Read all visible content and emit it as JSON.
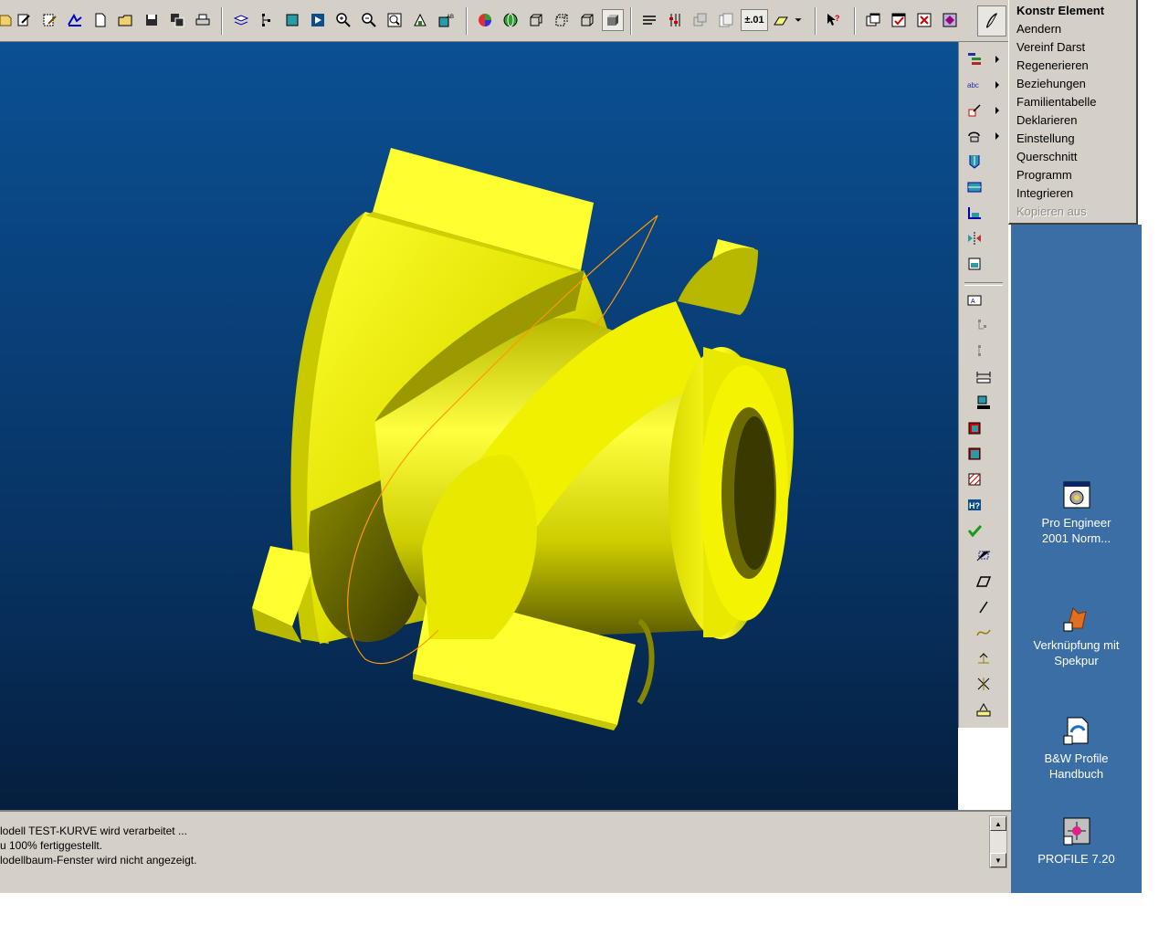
{
  "toolbar": {
    "icons": [
      "new-icon",
      "open-icon",
      "save-icon",
      "save-copy-icon",
      "print-icon",
      "edit-icon",
      "pen-icon",
      "erase-icon",
      "blank-page-icon",
      "folder-icon",
      "disk-icon",
      "multi-save-icon",
      "printer-icon",
      "layers-icon",
      "tree-icon",
      "cube-shade-icon",
      "repaint-icon",
      "zoom-in-icon",
      "zoom-out-icon",
      "zoom-fit-icon",
      "orient-icon",
      "saved-view-icon",
      "color-wheel-icon",
      "globe-icon",
      "wireframe-icon",
      "hidden-line-icon",
      "no-hidden-icon",
      "shaded-icon",
      "datum-plane-icon",
      "datum-axis-icon",
      "datum-point-icon",
      "csys-icon"
    ],
    "precision_label": "±.01",
    "whats_this_icon": "help-pointer-icon",
    "window_icons": [
      "window-activate-icon",
      "window-open-icon",
      "window-close-icon",
      "window-special-icon"
    ],
    "sketch_icon": "sketch-pen-icon"
  },
  "menu": {
    "items": [
      {
        "label": "Konstr Element",
        "style": "bold"
      },
      {
        "label": "Aendern",
        "style": "normal"
      },
      {
        "label": "Vereinf Darst",
        "style": "normal"
      },
      {
        "label": "Regenerieren",
        "style": "normal"
      },
      {
        "label": "Beziehungen",
        "style": "normal"
      },
      {
        "label": "Familientabelle",
        "style": "normal"
      },
      {
        "label": "Deklarieren",
        "style": "normal"
      },
      {
        "label": "Einstellung",
        "style": "normal"
      },
      {
        "label": "Querschnitt",
        "style": "normal"
      },
      {
        "label": "Programm",
        "style": "normal"
      },
      {
        "label": "Integrieren",
        "style": "normal"
      },
      {
        "label": "Kopieren aus",
        "style": "disabled"
      }
    ]
  },
  "messages": [
    "lodell TEST-KURVE wird verarbeitet ...",
    "u 100% fertiggestellt.",
    "lodellbaum-Fenster wird nicht angezeigt."
  ],
  "desktop": {
    "icons": [
      {
        "label1": "Pro Engineer",
        "label2": "2001 Norm...",
        "icon": "pro-engineer-icon"
      },
      {
        "label1": "Verknüpfung mit",
        "label2": "Spekpur",
        "icon": "spekpur-icon"
      },
      {
        "label1": "B&W Profile",
        "label2": "Handbuch",
        "icon": "handbook-icon"
      },
      {
        "label1": "PROFILE 7.20",
        "label2": "",
        "icon": "profile-icon"
      }
    ]
  },
  "colors": {
    "model_yellow": "#f4f400",
    "viewport_top": "#0a5093",
    "viewport_bottom": "#051e3d",
    "curve": "#ff9900",
    "desktop": "#3a6ea5",
    "chrome": "#d4d0c8"
  }
}
